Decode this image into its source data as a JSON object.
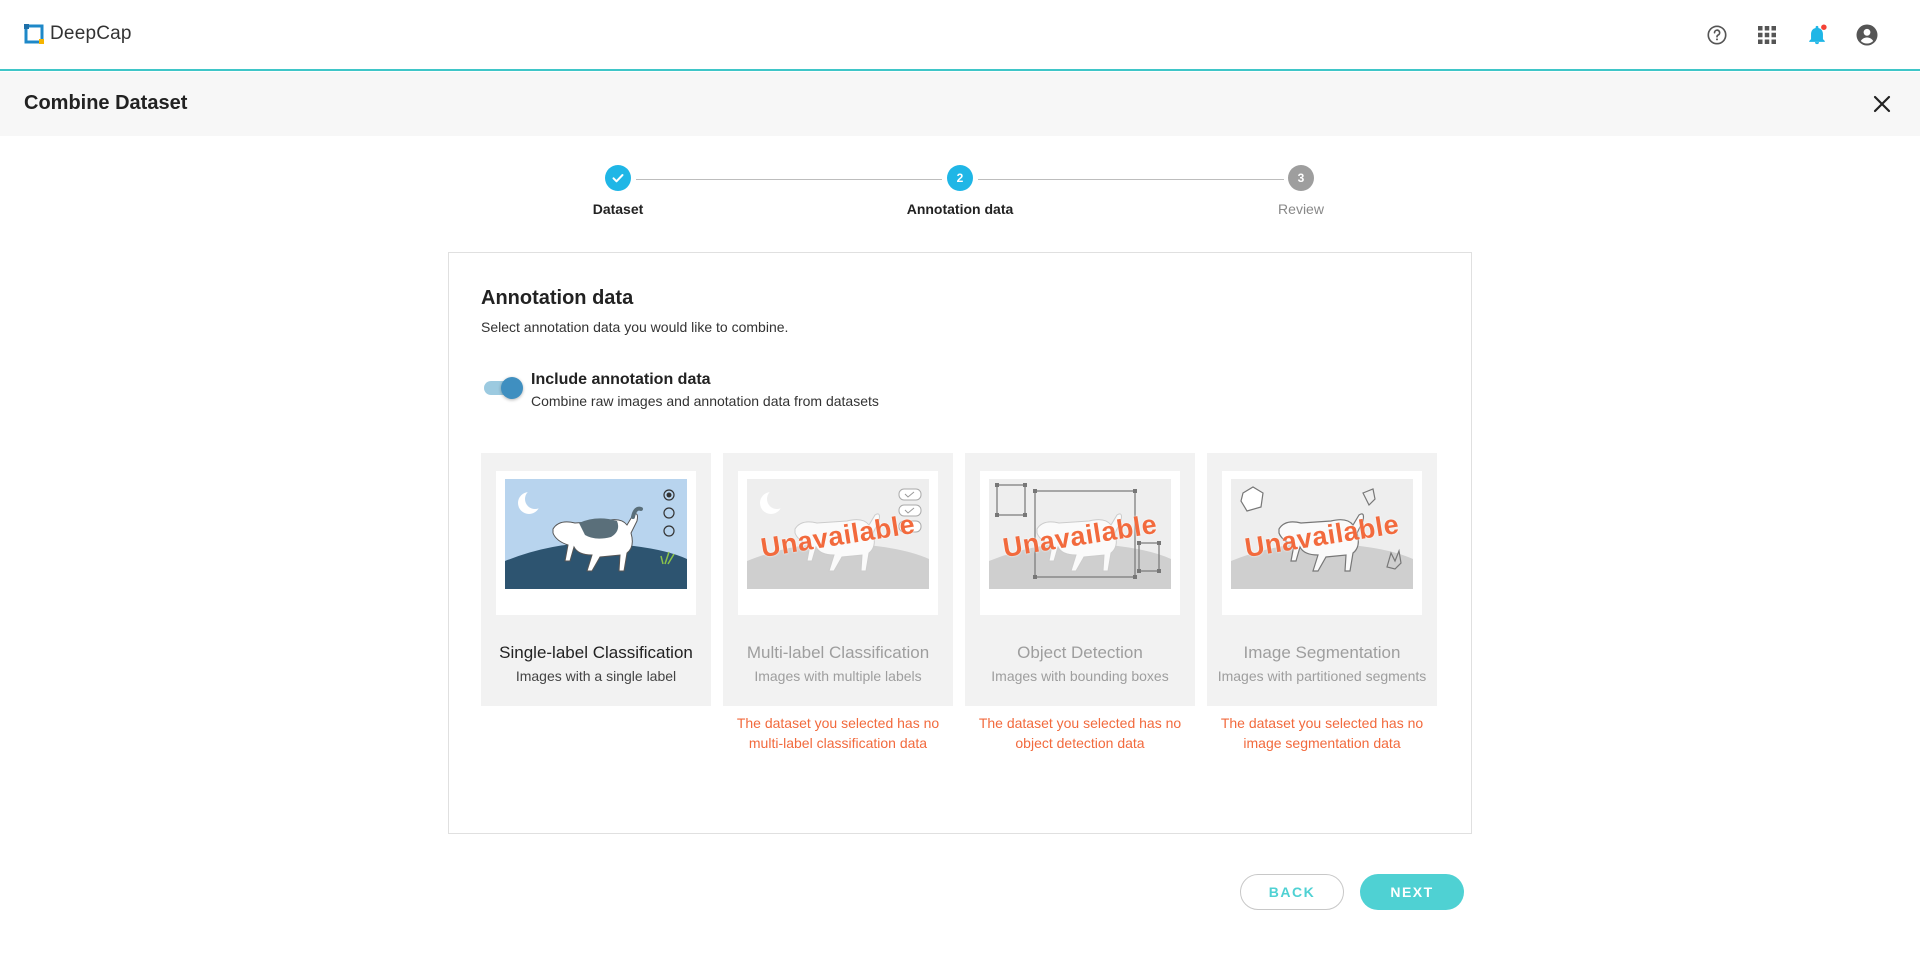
{
  "app": {
    "name": "DeepCap"
  },
  "header_icons": [
    "help-icon",
    "apps-grid-icon",
    "notification-bell-icon",
    "account-icon"
  ],
  "page": {
    "title": "Combine Dataset"
  },
  "stepper": {
    "steps": [
      {
        "number": "1",
        "label": "Dataset",
        "state": "completed"
      },
      {
        "number": "2",
        "label": "Annotation data",
        "state": "active"
      },
      {
        "number": "3",
        "label": "Review",
        "state": "pending"
      }
    ]
  },
  "section": {
    "title": "Annotation data",
    "subtitle": "Select annotation data you would like to combine."
  },
  "toggle": {
    "label": "Include annotation data",
    "description": "Combine raw images and annotation data from datasets",
    "checked": true
  },
  "options": [
    {
      "title": "Single-label Classification",
      "description": "Images with a single label",
      "available": true,
      "error": ""
    },
    {
      "title": "Multi-label Classification",
      "description": "Images with multiple labels",
      "available": false,
      "badge": "Unavailable",
      "error_line1": "The dataset you selected has no",
      "error_line2": "multi-label classification data"
    },
    {
      "title": "Object Detection",
      "description": "Images with bounding boxes",
      "available": false,
      "badge": "Unavailable",
      "error_line1": "The dataset you selected has no",
      "error_line2": "object detection data"
    },
    {
      "title": "Image Segmentation",
      "description": "Images with partitioned segments",
      "available": false,
      "badge": "Unavailable",
      "error_line1": "The dataset you selected has no",
      "error_line2": "image segmentation data"
    }
  ],
  "buttons": {
    "back": "BACK",
    "next": "NEXT"
  },
  "colors": {
    "accent": "#4fd1d3",
    "stepper_active": "#1fb6e6",
    "stepper_pending": "#9e9e9e",
    "error": "#f26a3d"
  }
}
